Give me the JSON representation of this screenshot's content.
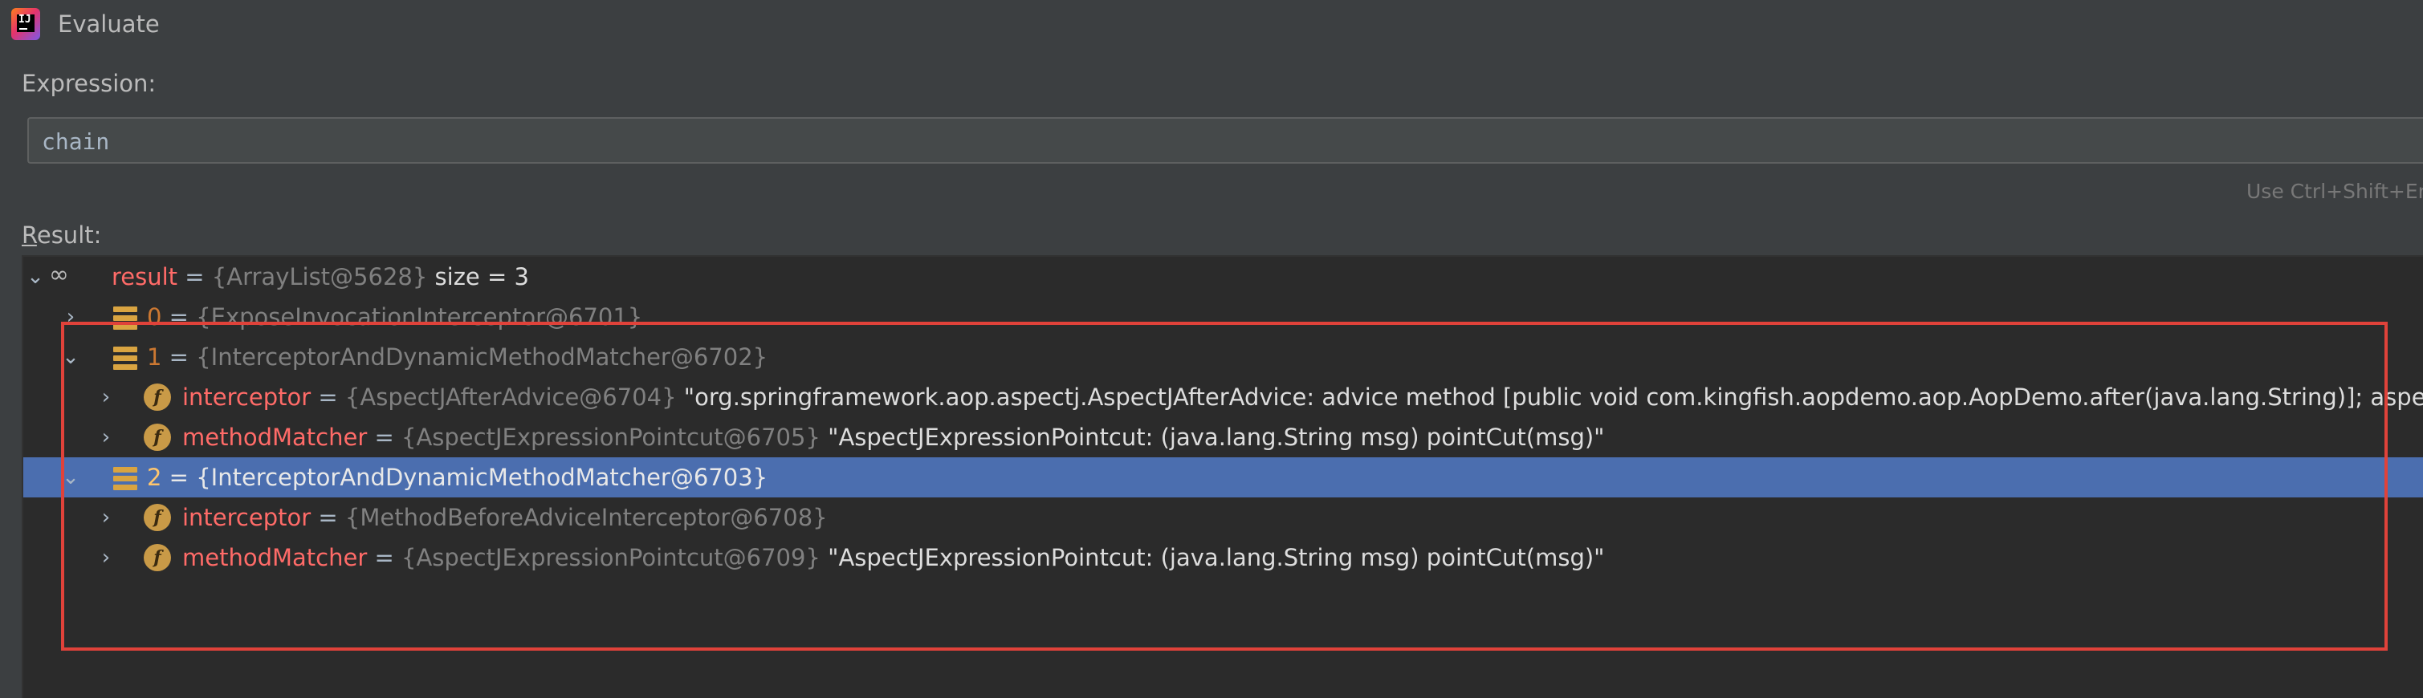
{
  "window": {
    "title": "Evaluate",
    "app_icon": "intellij-idea-icon"
  },
  "expression": {
    "label": "Expression:",
    "value": "chain"
  },
  "hint": "Use Ctrl+Shift+Er",
  "result": {
    "label_first": "R",
    "label_rest": "esult:",
    "rows": [
      {
        "name": "result",
        "eq": "=",
        "type": "{ArrayList@5628}",
        "value": "size = 3"
      },
      {
        "name": "0",
        "eq": "=",
        "type": "{ExposeInvocationInterceptor@6701}"
      },
      {
        "name": "1",
        "eq": "=",
        "type": "{InterceptorAndDynamicMethodMatcher@6702}"
      },
      {
        "name": "interceptor",
        "eq": "=",
        "type": "{AspectJAfterAdvice@6704}",
        "value": "\"org.springframework.aop.aspectj.AspectJAfterAdvice: advice method [public void com.kingfish.aopdemo.aop.AopDemo.after(java.lang.String)]; aspe"
      },
      {
        "name": "methodMatcher",
        "eq": "=",
        "type": "{AspectJExpressionPointcut@6705}",
        "value": "\"AspectJExpressionPointcut: (java.lang.String msg) pointCut(msg)\""
      },
      {
        "name": "2",
        "eq": "=",
        "type": "{InterceptorAndDynamicMethodMatcher@6703}"
      },
      {
        "name": "interceptor",
        "eq": "=",
        "type": "{MethodBeforeAdviceInterceptor@6708}"
      },
      {
        "name": "methodMatcher",
        "eq": "=",
        "type": "{AspectJExpressionPointcut@6709}",
        "value": "\"AspectJExpressionPointcut: (java.lang.String msg) pointCut(msg)\""
      }
    ]
  },
  "colors": {
    "background": "#3c3f41",
    "tree_background": "#2b2b2b",
    "selection": "#4b6eaf",
    "annotation": "#e0423a",
    "field_name": "#ff6b68"
  },
  "icons": {
    "expand": "chevron-down-icon",
    "collapse": "chevron-right-icon",
    "watch": "glasses-icon",
    "array_item": "array-element-icon",
    "field": "field-icon"
  }
}
